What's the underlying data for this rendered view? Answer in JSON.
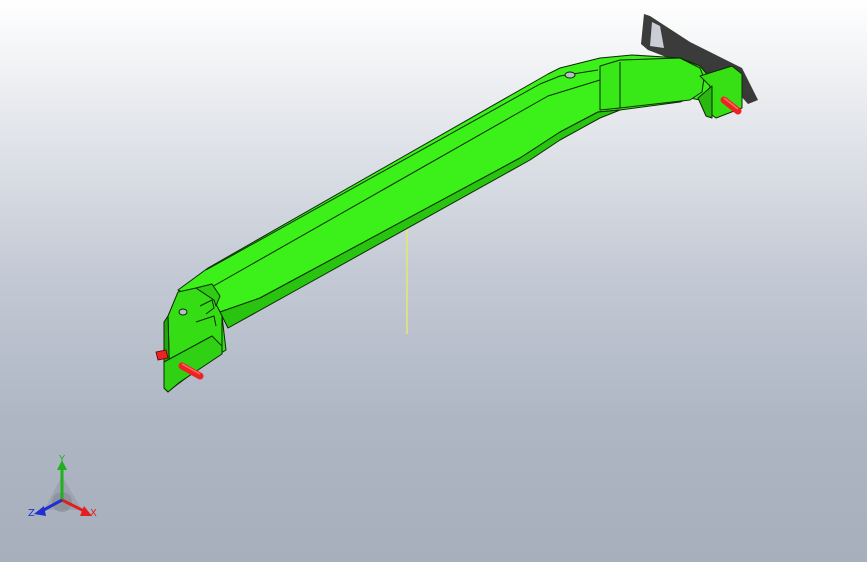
{
  "viewport": {
    "background_top": "#ffffff",
    "background_bottom": "#a7afbd"
  },
  "part": {
    "color": "#33ee11",
    "edge_color": "#0c2a04",
    "pin_color": "#ee2222",
    "shadow_color": "#1a1a1a",
    "center_line_color": "#e8e86a"
  },
  "triad": {
    "x_label": "X",
    "y_label": "Y",
    "z_label": "Z",
    "x_color": "#e02020",
    "y_color": "#20b020",
    "z_color": "#2030d0"
  }
}
